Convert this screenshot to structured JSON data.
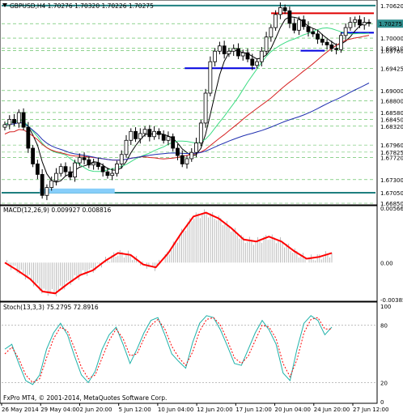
{
  "window": {
    "main_title": "GBPUSD,H4  1.70276 1.70320 1.70226 1.70275",
    "macd_title": "MACD(12,26,9) 0.009927 0.008816",
    "stoch_title": "Stoch(13,3,3) 75.2795 72.8916",
    "copyright": "FxPro MT4, © 2001-2014, MetaQuotes Software Corp."
  },
  "colors": {
    "background": "#ffffff",
    "candles": "#000000",
    "grid": "#4cb84c",
    "ma_black": "#000000",
    "ma_green": "#3ddc84",
    "ma_red": "#d62020",
    "ma_blue": "#2030b0",
    "level_teal": "#1f7f7f",
    "res_red": "#e00000",
    "sup_blue": "#0000e0",
    "support_box": "#87cefa",
    "price_tag": "#2f8f8f",
    "macd_line": "#ff0000",
    "macd_hist": "#bbbbbb",
    "stoch_main": "#20b2aa",
    "stoch_signal": "#ff0000"
  },
  "chart_data": [
    {
      "type": "candlestick",
      "symbol": "GBPUSD",
      "timeframe": "H4",
      "ohlc_current": {
        "open": 1.70276,
        "high": 1.7032,
        "low": 1.70226,
        "close": 1.70275
      },
      "x_ticks": [
        "26 May 2014",
        "29 May 04:00",
        "2 Jun 20:00",
        "5 Jun 12:00",
        "10 Jun 04:00",
        "12 Jun 20:00",
        "17 Jun 12:00",
        "20 Jun 04:00",
        "24 Jun 20:00",
        "27 Jun 12:00"
      ],
      "y_ticks": [
        "1.70620",
        "1.70275",
        "1.70000",
        "1.69810",
        "1.69760",
        "1.69425",
        "1.69000",
        "1.68800",
        "1.68580",
        "1.68450",
        "1.68320",
        "1.67960",
        "1.67825",
        "1.67720",
        "1.67300",
        "1.67050",
        "1.66850"
      ],
      "ylim": [
        1.6685,
        1.7068
      ],
      "series_close": [
        1.6835,
        1.6845,
        1.6838,
        1.6858,
        1.683,
        1.679,
        1.676,
        1.674,
        1.67,
        1.6715,
        1.6728,
        1.6742,
        1.6755,
        1.6745,
        1.6735,
        1.6762,
        1.6772,
        1.6768,
        1.6758,
        1.6762,
        1.6755,
        1.6745,
        1.6738,
        1.6742,
        1.676,
        1.6778,
        1.6805,
        1.6822,
        1.6808,
        1.6818,
        1.6826,
        1.6812,
        1.6822,
        1.6816,
        1.6805,
        1.6812,
        1.679,
        1.6776,
        1.676,
        1.677,
        1.6782,
        1.68,
        1.6838,
        1.6895,
        1.6955,
        1.6975,
        1.6985,
        1.697,
        1.6975,
        1.698,
        1.6966,
        1.6972,
        1.696,
        1.6948,
        1.6955,
        1.6975,
        1.7002,
        1.702,
        1.7045,
        1.7058,
        1.7052,
        1.7028,
        1.7015,
        1.7035,
        1.7022,
        1.7012,
        1.7008,
        1.6998,
        1.6992,
        1.6987,
        1.698,
        1.6978,
        1.7005,
        1.702,
        1.703,
        1.7035,
        1.7025,
        1.703,
        1.7028
      ],
      "levels": {
        "top_teal": 1.7062,
        "bottom_teal": 1.6705,
        "resistance_red": 1.70473,
        "support_blue_high": 1.70103,
        "support_blue_mid": 1.69425,
        "support_blue_low": 1.6976,
        "support_box": [
          1.67,
          1.671
        ]
      },
      "moving_averages": [
        "black",
        "green",
        "red",
        "blue"
      ]
    },
    {
      "type": "line",
      "name": "MACD(12,26,9)",
      "y_ticks": [
        "0.005669",
        "0.00",
        "-0.003853"
      ],
      "ylim": [
        -0.003853,
        0.005669
      ],
      "macd_line": [
        0.0,
        -0.0008,
        -0.0017,
        -0.003,
        -0.0032,
        -0.0022,
        -0.0013,
        -0.0008,
        0.0002,
        0.001,
        0.0008,
        -0.0002,
        -0.0005,
        0.001,
        0.003,
        0.0048,
        0.0052,
        0.0046,
        0.0036,
        0.0024,
        0.0022,
        0.0027,
        0.0022,
        0.0012,
        0.0004,
        0.0006,
        0.001
      ]
    },
    {
      "type": "line",
      "name": "Stoch(13,3,3)",
      "y_ticks": [
        "100",
        "80",
        "20",
        "0"
      ],
      "ylim": [
        0,
        100
      ],
      "main": [
        55,
        60,
        40,
        22,
        18,
        28,
        55,
        72,
        82,
        70,
        48,
        28,
        20,
        32,
        55,
        70,
        78,
        60,
        40,
        55,
        72,
        85,
        88,
        70,
        50,
        42,
        35,
        62,
        82,
        90,
        88,
        75,
        58,
        40,
        38,
        55,
        72,
        85,
        75,
        60,
        30,
        22,
        55,
        82,
        90,
        85,
        70,
        78
      ],
      "signal": [
        50,
        57,
        45,
        28,
        20,
        24,
        46,
        66,
        78,
        74,
        56,
        36,
        24,
        28,
        46,
        64,
        76,
        66,
        48,
        50,
        66,
        80,
        86,
        76,
        58,
        46,
        38,
        52,
        74,
        86,
        88,
        80,
        64,
        46,
        40,
        48,
        64,
        80,
        78,
        66,
        40,
        26,
        44,
        72,
        86,
        88,
        76,
        76
      ]
    }
  ]
}
